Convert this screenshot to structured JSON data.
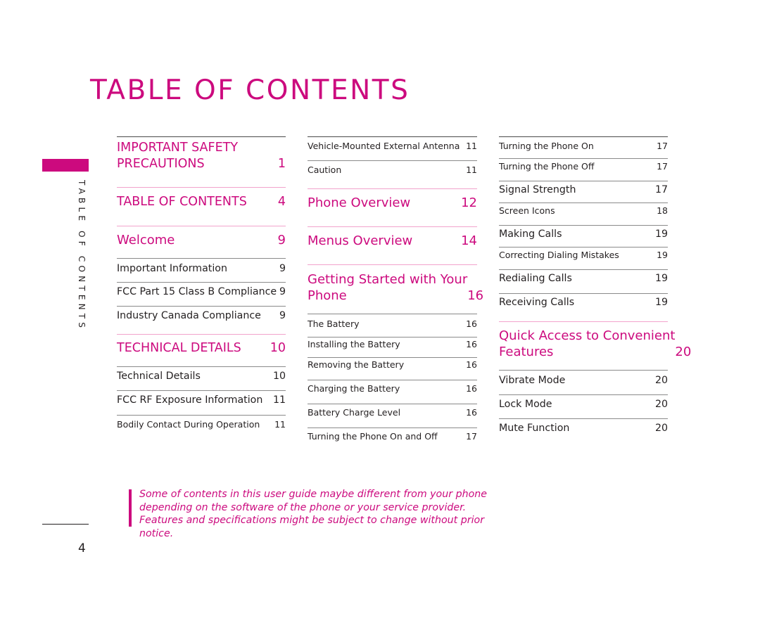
{
  "page": {
    "title": "TABLE OF CONTENTS",
    "side_label": "TABLE OF CONTENTS",
    "page_number": "4",
    "accent_color": "#cc0a7e"
  },
  "columns": [
    {
      "entries": [
        {
          "type": "section",
          "label_lines": [
            "IMPORTANT SAFETY",
            "PRECAUTIONS"
          ],
          "page": "1"
        },
        {
          "type": "section",
          "label": "TABLE OF CONTENTS",
          "page": "4"
        },
        {
          "type": "section",
          "label": "Welcome",
          "page": "9"
        },
        {
          "type": "item",
          "label": "Important Information",
          "page": "9"
        },
        {
          "type": "item",
          "label": "FCC Part 15 Class B Compliance",
          "page": "9"
        },
        {
          "type": "item",
          "label": "Industry Canada Compliance",
          "page": "9"
        },
        {
          "type": "section",
          "label": "TECHNICAL DETAILS",
          "page": "10"
        },
        {
          "type": "item",
          "label": "Technical Details",
          "page": "10"
        },
        {
          "type": "item",
          "label": "FCC RF Exposure Information",
          "page": "11"
        },
        {
          "type": "item",
          "label": "Bodily Contact During Operation",
          "page": "11"
        }
      ]
    },
    {
      "entries": [
        {
          "type": "item",
          "label": "Vehicle-Mounted External Antenna",
          "page": "11"
        },
        {
          "type": "item",
          "label": "Caution",
          "page": "11"
        },
        {
          "type": "section",
          "label": "Phone Overview",
          "page": "12"
        },
        {
          "type": "section",
          "label": "Menus Overview",
          "page": "14"
        },
        {
          "type": "section",
          "label_lines": [
            "Getting Started with Your",
            "Phone"
          ],
          "page": "16"
        },
        {
          "type": "item",
          "label": "The Battery",
          "page": "16"
        },
        {
          "type": "item",
          "label": "Installing the Battery",
          "page": "16"
        },
        {
          "type": "item",
          "label": "Removing the Battery",
          "page": "16"
        },
        {
          "type": "item",
          "label": "Charging the Battery",
          "page": "16"
        },
        {
          "type": "item",
          "label": "Battery Charge Level",
          "page": "16"
        },
        {
          "type": "item",
          "label": "Turning the Phone On and Off",
          "page": "17"
        }
      ]
    },
    {
      "entries": [
        {
          "type": "item",
          "label": "Turning the Phone On",
          "page": "17"
        },
        {
          "type": "item",
          "label": "Turning the Phone Off",
          "page": "17"
        },
        {
          "type": "item",
          "label": "Signal Strength",
          "page": "17"
        },
        {
          "type": "item",
          "label": "Screen Icons",
          "page": "18"
        },
        {
          "type": "item",
          "label": "Making Calls",
          "page": "19"
        },
        {
          "type": "item",
          "label": "Correcting Dialing Mistakes",
          "page": "19"
        },
        {
          "type": "item",
          "label": "Redialing Calls",
          "page": "19"
        },
        {
          "type": "item",
          "label": "Receiving Calls",
          "page": "19"
        },
        {
          "type": "section",
          "label_lines": [
            "Quick Access to Convenient",
            "Features"
          ],
          "page": "20"
        },
        {
          "type": "item",
          "label": "Vibrate Mode",
          "page": "20"
        },
        {
          "type": "item",
          "label": "Lock Mode",
          "page": "20"
        },
        {
          "type": "item",
          "label": "Mute Function",
          "page": "20"
        }
      ]
    }
  ],
  "note": "Some of contents in this user guide maybe different from your phone depending on the software of the phone or your service provider. Features and specifications might be subject to change without prior notice."
}
